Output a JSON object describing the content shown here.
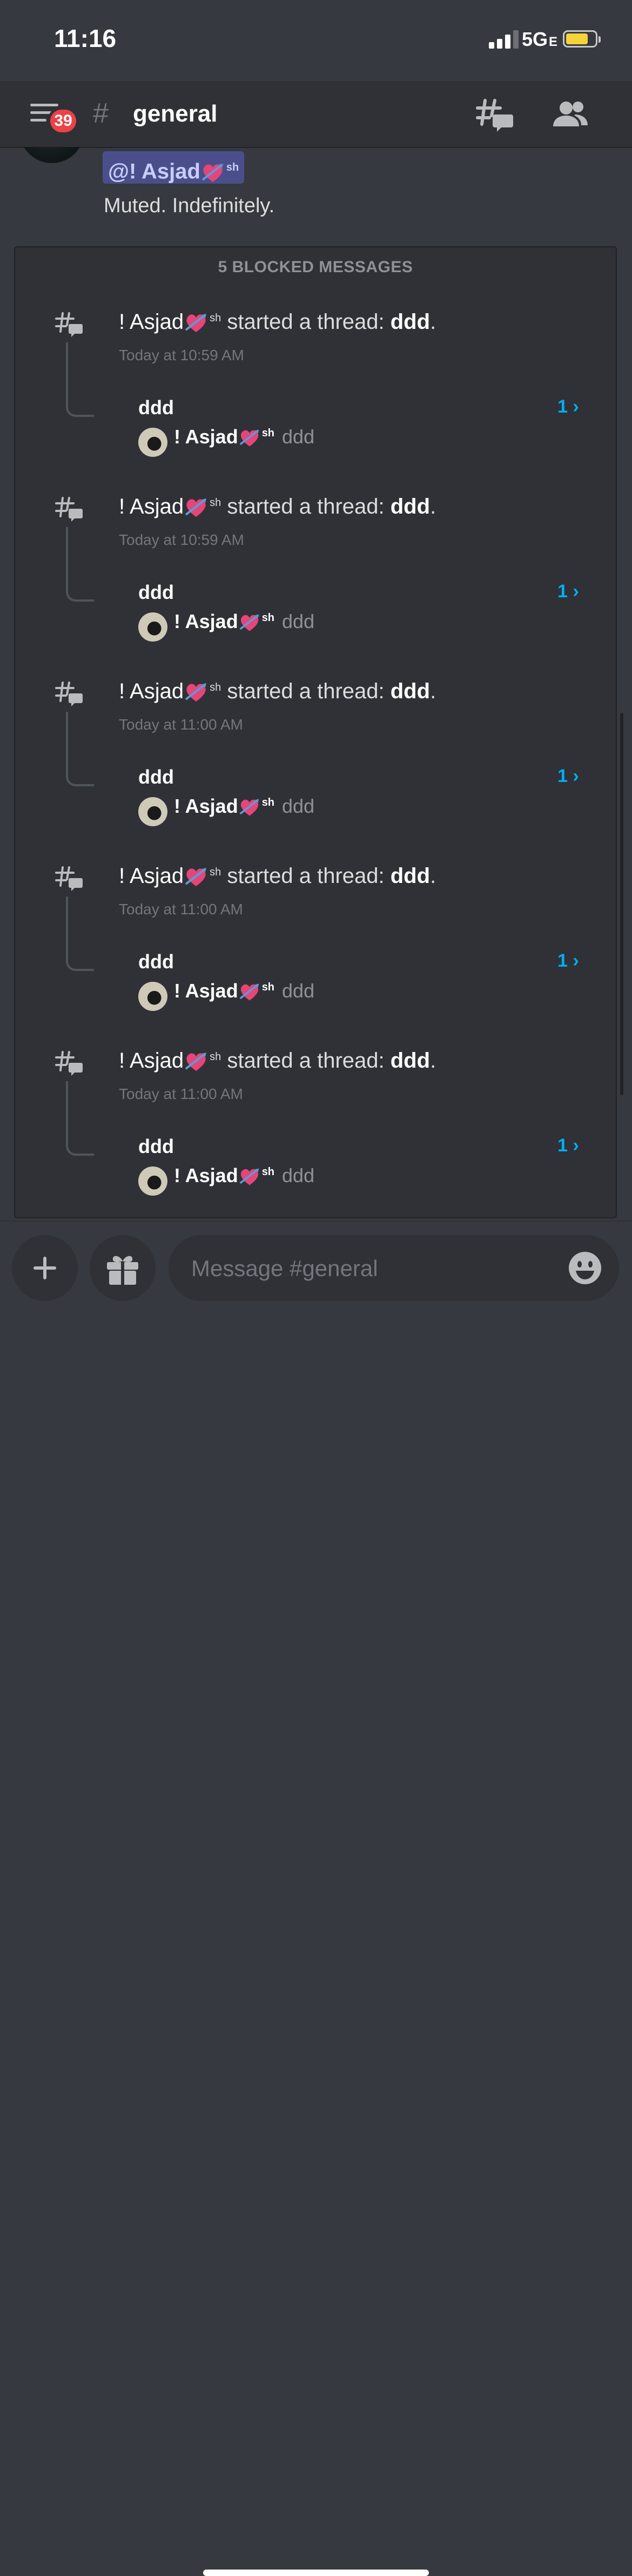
{
  "status_bar": {
    "time": "11:16",
    "network": "5G",
    "network_suffix": "E"
  },
  "header": {
    "badge": "39",
    "channel_hash": "#",
    "channel": "general"
  },
  "top_message": {
    "mention": "@! Asjad",
    "mention_sup": "sh",
    "text": "Muted. Indefinitely."
  },
  "blocked": {
    "label": "5 BLOCKED MESSAGES",
    "items": [
      {
        "user": "! Asjad",
        "sup": "sh",
        "action": "started a thread:",
        "thread": "ddd",
        "time": "Today at 10:59 AM",
        "thread_name": "ddd",
        "count": "1 ›",
        "reply_user": "! Asjad",
        "reply_sup": "sh",
        "reply_text": "ddd"
      },
      {
        "user": "! Asjad",
        "sup": "sh",
        "action": "started a thread:",
        "thread": "ddd",
        "time": "Today at 10:59 AM",
        "thread_name": "ddd",
        "count": "1 ›",
        "reply_user": "! Asjad",
        "reply_sup": "sh",
        "reply_text": "ddd"
      },
      {
        "user": "! Asjad",
        "sup": "sh",
        "action": "started a thread:",
        "thread": "ddd",
        "time": "Today at 11:00 AM",
        "thread_name": "ddd",
        "count": "1 ›",
        "reply_user": "! Asjad",
        "reply_sup": "sh",
        "reply_text": "ddd"
      },
      {
        "user": "! Asjad",
        "sup": "sh",
        "action": "started a thread:",
        "thread": "ddd",
        "time": "Today at 11:00 AM",
        "thread_name": "ddd",
        "count": "1 ›",
        "reply_user": "! Asjad",
        "reply_sup": "sh",
        "reply_text": "ddd"
      },
      {
        "user": "! Asjad",
        "sup": "sh",
        "action": "started a thread:",
        "thread": "ddd",
        "time": "Today at 11:00 AM",
        "thread_name": "ddd",
        "count": "1 ›",
        "reply_user": "! Asjad",
        "reply_sup": "sh",
        "reply_text": "ddd"
      }
    ]
  },
  "composer": {
    "placeholder": "Message #general"
  },
  "icons": {
    "menu": "hamburger-menu-icon",
    "threads": "threads-icon",
    "members": "members-icon",
    "plus": "plus-icon",
    "gift": "gift-icon",
    "emoji": "emoji-icon",
    "heart": "sparkling-heart-emoji"
  },
  "colors": {
    "background": "#36393f",
    "header": "#2f3136",
    "badge": "#ed4245",
    "link": "#00aff4",
    "mention_bg": "#4a4f8c"
  }
}
